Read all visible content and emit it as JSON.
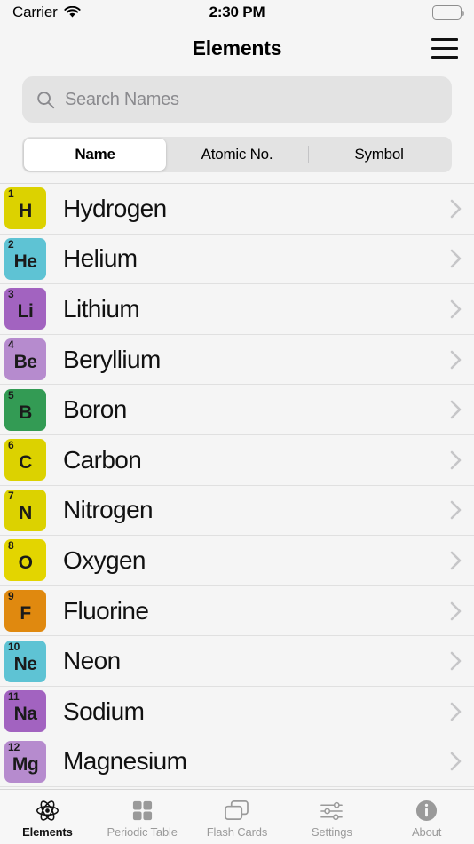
{
  "status_bar": {
    "carrier": "Carrier",
    "wifi_icon": "wifi-icon",
    "time": "2:30 PM",
    "battery_icon": "battery-full-icon"
  },
  "navbar": {
    "title": "Elements",
    "menu_icon": "hamburger-menu-icon"
  },
  "search": {
    "icon": "search-icon",
    "placeholder": "Search Names",
    "value": ""
  },
  "segmented_control": {
    "selected_index": 0,
    "options": [
      {
        "label": "Name",
        "selected": true
      },
      {
        "label": "Atomic No.",
        "selected": false
      },
      {
        "label": "Symbol",
        "selected": false
      }
    ]
  },
  "list": {
    "disclosure_icon": "chevron-right-icon",
    "rows": [
      {
        "number": "1",
        "symbol": "H",
        "name": "Hydrogen",
        "color": "#DCD200"
      },
      {
        "number": "2",
        "symbol": "He",
        "name": "Helium",
        "color": "#5EC3D4"
      },
      {
        "number": "3",
        "symbol": "Li",
        "name": "Lithium",
        "color": "#A263C0"
      },
      {
        "number": "4",
        "symbol": "Be",
        "name": "Beryllium",
        "color": "#B68BCE"
      },
      {
        "number": "5",
        "symbol": "B",
        "name": "Boron",
        "color": "#339B54"
      },
      {
        "number": "6",
        "symbol": "C",
        "name": "Carbon",
        "color": "#DCD200"
      },
      {
        "number": "7",
        "symbol": "N",
        "name": "Nitrogen",
        "color": "#DCD200"
      },
      {
        "number": "8",
        "symbol": "O",
        "name": "Oxygen",
        "color": "#E3D500"
      },
      {
        "number": "9",
        "symbol": "F",
        "name": "Fluorine",
        "color": "#E0890F"
      },
      {
        "number": "10",
        "symbol": "Ne",
        "name": "Neon",
        "color": "#5EC3D4"
      },
      {
        "number": "11",
        "symbol": "Na",
        "name": "Sodium",
        "color": "#A263C0"
      },
      {
        "number": "12",
        "symbol": "Mg",
        "name": "Magnesium",
        "color": "#B68BCE"
      }
    ]
  },
  "tab_bar": {
    "active_index": 0,
    "tabs": [
      {
        "label": "Elements",
        "icon": "atom-icon",
        "active": true
      },
      {
        "label": "Periodic Table",
        "icon": "grid-squares-icon",
        "active": false
      },
      {
        "label": "Flash Cards",
        "icon": "stacked-cards-icon",
        "active": false
      },
      {
        "label": "Settings",
        "icon": "sliders-icon",
        "active": false
      },
      {
        "label": "About",
        "icon": "info-circle-icon",
        "active": false
      }
    ]
  },
  "colors": {
    "background": "#F5F5F5",
    "search_field": "#E3E3E3",
    "segment_track": "#E3E3E3",
    "segment_selected": "#FFFFFF",
    "separator": "#E0E0E0",
    "tab_inactive": "#9A9A9A",
    "tab_active": "#111111",
    "placeholder_text": "#8A8A8E"
  }
}
